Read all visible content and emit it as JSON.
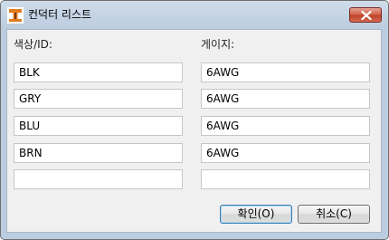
{
  "window": {
    "title": "컨덕터 리스트"
  },
  "icons": {
    "app": "app-logo-icon",
    "close": "close-icon"
  },
  "columns": {
    "color_label": "색상/ID:",
    "gauge_label": "게이지:"
  },
  "rows": [
    {
      "color": "BLK",
      "gauge": "6AWG"
    },
    {
      "color": "GRY",
      "gauge": "6AWG"
    },
    {
      "color": "BLU",
      "gauge": "6AWG"
    },
    {
      "color": "BRN",
      "gauge": "6AWG"
    },
    {
      "color": "",
      "gauge": ""
    }
  ],
  "buttons": {
    "ok_label": "확인(O)",
    "cancel_label": "취소(C)"
  },
  "colors": {
    "title_bar": "#bccde0",
    "close_button": "#c0412a",
    "dialog_body": "#f0f0f0",
    "app_icon_accent": "#e07a1e"
  }
}
